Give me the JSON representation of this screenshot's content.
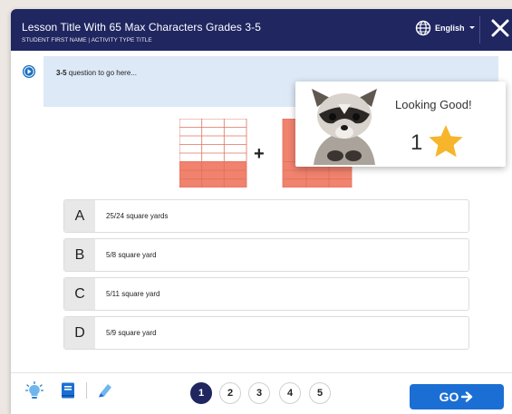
{
  "header": {
    "lesson_title": "Lesson Title With 65 Max Characters Grades 3-5",
    "subtitle": "STUDENT FIRST NAME | ACTIVITY TYPE TITLE",
    "language": "English"
  },
  "question": {
    "grade_prefix": "3-5",
    "text": " question to go here..."
  },
  "equation": {
    "operator": "+"
  },
  "popup": {
    "title": "Looking Good!",
    "star_count": "1"
  },
  "answers": [
    {
      "letter": "A",
      "text": "25/24 square yards"
    },
    {
      "letter": "B",
      "text": "5/8 square yard"
    },
    {
      "letter": "C",
      "text": "5/11 square yard"
    },
    {
      "letter": "D",
      "text": "5/9 square yard"
    }
  ],
  "pagination": {
    "pages": [
      "1",
      "2",
      "3",
      "4",
      "5"
    ],
    "current": "1"
  },
  "footer": {
    "go_label": "GO"
  },
  "colors": {
    "header_bg": "#1f2660",
    "question_bg": "#dde9f7",
    "accent_blue": "#1b6fd4",
    "fraction_fill": "#f0826e",
    "star": "#f7b52b"
  },
  "icons": {
    "tools": [
      "lightbulb-icon",
      "book-icon",
      "highlighter-icon"
    ],
    "header": [
      "globe-icon",
      "close-icon"
    ],
    "question": "play-audio-icon",
    "go": "arrow-right-icon"
  }
}
